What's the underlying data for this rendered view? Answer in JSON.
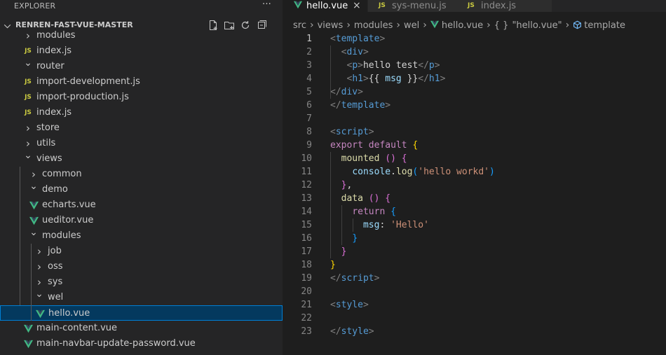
{
  "explorer": {
    "title": "EXPLORER",
    "more": "···",
    "project": "RENREN-FAST-VUE-MASTER",
    "tree": [
      {
        "label": "modules",
        "kind": "folder",
        "state": "closed",
        "depth": 1
      },
      {
        "label": "index.js",
        "kind": "js",
        "depth": 1
      },
      {
        "label": "router",
        "kind": "folder",
        "state": "open",
        "depth": 1
      },
      {
        "label": "import-development.js",
        "kind": "js",
        "depth": 1
      },
      {
        "label": "import-production.js",
        "kind": "js",
        "depth": 1
      },
      {
        "label": "index.js",
        "kind": "js",
        "depth": 1
      },
      {
        "label": "store",
        "kind": "folder",
        "state": "closed",
        "depth": 1
      },
      {
        "label": "utils",
        "kind": "folder",
        "state": "closed",
        "depth": 1
      },
      {
        "label": "views",
        "kind": "folder",
        "state": "open",
        "depth": 1
      },
      {
        "label": "common",
        "kind": "folder",
        "state": "closed",
        "depth": 2
      },
      {
        "label": "demo",
        "kind": "folder",
        "state": "open",
        "depth": 2
      },
      {
        "label": "echarts.vue",
        "kind": "vue",
        "depth": 2
      },
      {
        "label": "ueditor.vue",
        "kind": "vue",
        "depth": 2
      },
      {
        "label": "modules",
        "kind": "folder",
        "state": "open",
        "depth": 2
      },
      {
        "label": "job",
        "kind": "folder",
        "state": "closed",
        "depth": 3
      },
      {
        "label": "oss",
        "kind": "folder",
        "state": "closed",
        "depth": 3
      },
      {
        "label": "sys",
        "kind": "folder",
        "state": "closed",
        "depth": 3
      },
      {
        "label": "wel",
        "kind": "folder",
        "state": "open",
        "depth": 3
      },
      {
        "label": "hello.vue",
        "kind": "vue",
        "depth": 3,
        "selected": true
      },
      {
        "label": "main-content.vue",
        "kind": "vue",
        "depth": 1
      },
      {
        "label": "main-navbar-update-password.vue",
        "kind": "vue",
        "depth": 1
      }
    ]
  },
  "tabs": [
    {
      "label": "hello.vue",
      "kind": "vue",
      "active": true,
      "close": "×"
    },
    {
      "label": "sys-menu.js",
      "kind": "js",
      "active": false
    },
    {
      "label": "index.js",
      "kind": "js",
      "active": false
    }
  ],
  "breadcrumb": {
    "parts": [
      "src",
      "views",
      "modules",
      "wel",
      "hello.vue",
      "\"hello.vue\"",
      "template"
    ],
    "braces": "{ }"
  },
  "code": {
    "current_line": 1,
    "lines": [
      [
        [
          "t-br",
          "<"
        ],
        [
          "t-tag",
          "template"
        ],
        [
          "t-br",
          ">"
        ]
      ],
      [
        [
          "t-txt",
          "  "
        ],
        [
          "t-br",
          "<"
        ],
        [
          "t-tag",
          "div"
        ],
        [
          "t-br",
          ">"
        ]
      ],
      [
        [
          "t-txt",
          "   "
        ],
        [
          "t-br",
          "<"
        ],
        [
          "t-tag",
          "p"
        ],
        [
          "t-br",
          ">"
        ],
        [
          "t-txt",
          "hello test"
        ],
        [
          "t-br",
          "</"
        ],
        [
          "t-tag",
          "p"
        ],
        [
          "t-br",
          ">"
        ]
      ],
      [
        [
          "t-txt",
          "   "
        ],
        [
          "t-br",
          "<"
        ],
        [
          "t-tag",
          "h1"
        ],
        [
          "t-br",
          ">"
        ],
        [
          "t-txt",
          "{{ "
        ],
        [
          "t-var",
          "msg"
        ],
        [
          "t-txt",
          " }}"
        ],
        [
          "t-br",
          "</"
        ],
        [
          "t-tag",
          "h1"
        ],
        [
          "t-br",
          ">"
        ]
      ],
      [
        [
          "t-br",
          "</"
        ],
        [
          "t-tag",
          "div"
        ],
        [
          "t-br",
          ">"
        ]
      ],
      [
        [
          "t-br",
          "</"
        ],
        [
          "t-tag",
          "template"
        ],
        [
          "t-br",
          ">"
        ]
      ],
      [],
      [
        [
          "t-br",
          "<"
        ],
        [
          "t-tag",
          "script"
        ],
        [
          "t-br",
          ">"
        ]
      ],
      [
        [
          "t-kw",
          "export default "
        ],
        [
          "t-b1",
          "{"
        ]
      ],
      [
        [
          "t-txt",
          "  "
        ],
        [
          "t-fn",
          "mounted"
        ],
        [
          "t-txt",
          " "
        ],
        [
          "t-b2",
          "()"
        ],
        [
          "t-txt",
          " "
        ],
        [
          "t-b2",
          "{"
        ]
      ],
      [
        [
          "t-txt",
          "    "
        ],
        [
          "t-var",
          "console"
        ],
        [
          "t-pun",
          "."
        ],
        [
          "t-fn",
          "log"
        ],
        [
          "t-b3",
          "("
        ],
        [
          "t-str",
          "'hello workd'"
        ],
        [
          "t-b3",
          ")"
        ]
      ],
      [
        [
          "t-txt",
          "  "
        ],
        [
          "t-b2",
          "}"
        ],
        [
          "t-pun",
          ","
        ]
      ],
      [
        [
          "t-txt",
          "  "
        ],
        [
          "t-fn",
          "data"
        ],
        [
          "t-txt",
          " "
        ],
        [
          "t-b2",
          "()"
        ],
        [
          "t-txt",
          " "
        ],
        [
          "t-b2",
          "{"
        ]
      ],
      [
        [
          "t-txt",
          "    "
        ],
        [
          "t-kw",
          "return"
        ],
        [
          "t-txt",
          " "
        ],
        [
          "t-b3",
          "{"
        ]
      ],
      [
        [
          "t-txt",
          "      "
        ],
        [
          "t-var",
          "msg"
        ],
        [
          "t-pun",
          ": "
        ],
        [
          "t-str",
          "'Hello'"
        ]
      ],
      [
        [
          "t-txt",
          "    "
        ],
        [
          "t-b3",
          "}"
        ]
      ],
      [
        [
          "t-txt",
          "  "
        ],
        [
          "t-b2",
          "}"
        ]
      ],
      [
        [
          "t-b1",
          "}"
        ]
      ],
      [
        [
          "t-br",
          "</"
        ],
        [
          "t-tag",
          "script"
        ],
        [
          "t-br",
          ">"
        ]
      ],
      [],
      [
        [
          "t-br",
          "<"
        ],
        [
          "t-tag",
          "style"
        ],
        [
          "t-br",
          ">"
        ]
      ],
      [],
      [
        [
          "t-br",
          "</"
        ],
        [
          "t-tag",
          "style"
        ],
        [
          "t-br",
          ">"
        ]
      ]
    ]
  },
  "colors": {
    "accent": "#007fd4",
    "selection": "#04395e",
    "vue_green": "#41b883",
    "js_yellow": "#cbcb41"
  }
}
